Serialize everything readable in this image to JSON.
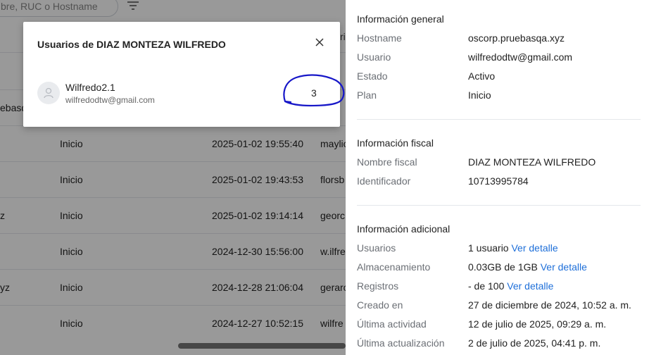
{
  "background": {
    "search_placeholder": "bre, RUC o Hostname",
    "header_partial": "ria",
    "rows": [
      {
        "name": "ebasq",
        "plan": "",
        "date": "",
        "user": "ec"
      },
      {
        "name": "",
        "plan": "Inicio",
        "date": "2025-01-02 19:55:40",
        "user": "maylio"
      },
      {
        "name": "",
        "plan": "Inicio",
        "date": "2025-01-02 19:43:53",
        "user": "florsb"
      },
      {
        "name": "z",
        "plan": "Inicio",
        "date": "2025-01-02 19:14:14",
        "user": "georc"
      },
      {
        "name": "",
        "plan": "Inicio",
        "date": "2024-12-30 15:56:00",
        "user": "w.ilfre"
      },
      {
        "name": "yz",
        "plan": "Inicio",
        "date": "2024-12-28 21:06:04",
        "user": "gerarc"
      },
      {
        "name": "",
        "plan": "Inicio",
        "date": "2024-12-27 10:52:15",
        "user": "wilfre"
      }
    ]
  },
  "modal": {
    "title": "Usuarios de DIAZ MONTEZA WILFREDO",
    "user": {
      "name": "Wilfredo2.1",
      "email": "wilfredodtw@gmail.com",
      "count": "3"
    }
  },
  "panel": {
    "general": {
      "title": "Información general",
      "rows": [
        {
          "label": "Hostname",
          "value": "oscorp.pruebasqa.xyz"
        },
        {
          "label": "Usuario",
          "value": "wilfredodtw@gmail.com"
        },
        {
          "label": "Estado",
          "value": "Activo"
        },
        {
          "label": "Plan",
          "value": "Inicio"
        }
      ]
    },
    "fiscal": {
      "title": "Información fiscal",
      "rows": [
        {
          "label": "Nombre fiscal",
          "value": "DIAZ MONTEZA WILFREDO"
        },
        {
          "label": "Identificador",
          "value": "10713995784"
        }
      ]
    },
    "additional": {
      "title": "Información adicional",
      "rows": [
        {
          "label": "Usuarios",
          "value": "1 usuario",
          "link": "Ver detalle"
        },
        {
          "label": "Almacenamiento",
          "value": "0.03GB de 1GB",
          "link": "Ver detalle"
        },
        {
          "label": "Registros",
          "value": "- de 100",
          "link": "Ver detalle"
        },
        {
          "label": "Creado en",
          "value": "27 de diciembre de 2024, 10:52 a. m."
        },
        {
          "label": "Última actividad",
          "value": "12 de julio de 2025, 09:29 a. m."
        },
        {
          "label": "Última actualización",
          "value": "2 de julio de 2025, 04:41 p. m."
        }
      ]
    }
  },
  "colors": {
    "link": "#1e6fd9",
    "annotation": "#1717c8"
  }
}
